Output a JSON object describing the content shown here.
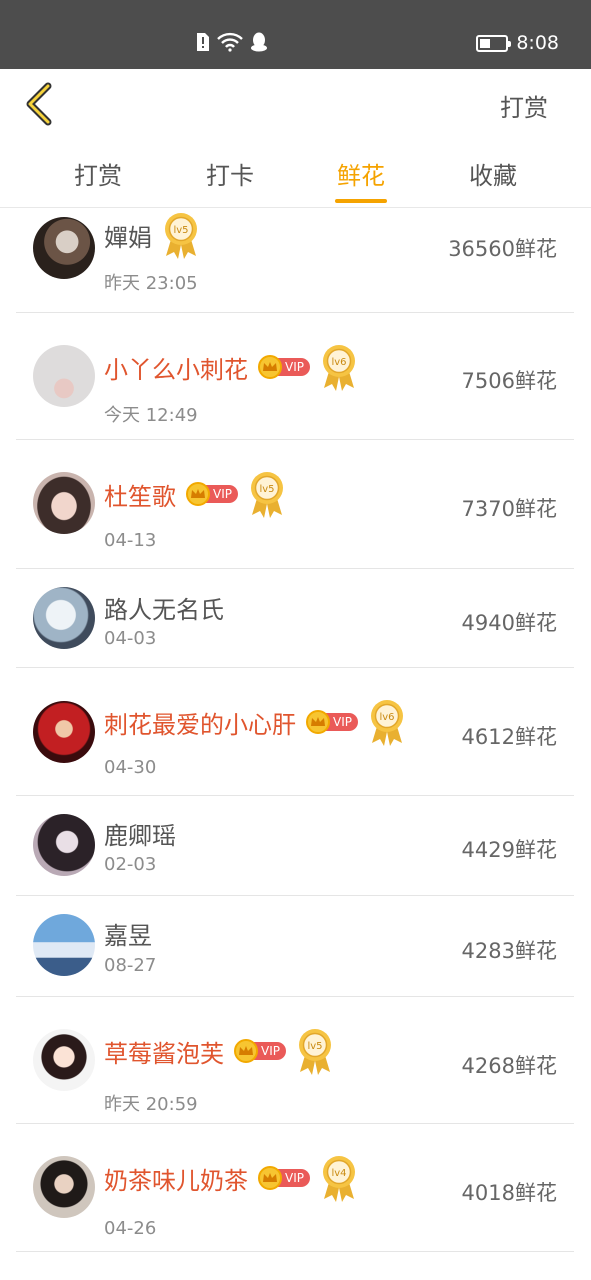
{
  "status": {
    "time": "8:08"
  },
  "nav": {
    "action": "打赏"
  },
  "tabs": [
    {
      "label": "打赏",
      "active": false
    },
    {
      "label": "打卡",
      "active": false
    },
    {
      "label": "鲜花",
      "active": true
    },
    {
      "label": "收藏",
      "active": false
    }
  ],
  "colors": {
    "accent": "#f5a300",
    "vip_name": "#e0552e",
    "vip_tag": "#ea5a58"
  },
  "rows": [
    {
      "name": "嬋娟",
      "vip": false,
      "level": "lv5",
      "time": "昨天 23:05",
      "amount": "36560鲜花"
    },
    {
      "name": "小丫么小刺花",
      "vip": true,
      "level": "lv6",
      "time": "今天 12:49",
      "amount": "7506鲜花"
    },
    {
      "name": "杜笙歌",
      "vip": true,
      "level": "lv5",
      "time": "04-13",
      "amount": "7370鲜花"
    },
    {
      "name": "路人无名氏",
      "vip": false,
      "level": "",
      "time": "04-03",
      "amount": "4940鲜花"
    },
    {
      "name": "刺花最爱的小心肝",
      "vip": true,
      "level": "lv6",
      "time": "04-30",
      "amount": "4612鲜花"
    },
    {
      "name": "鹿卿瑶",
      "vip": false,
      "level": "",
      "time": "02-03",
      "amount": "4429鲜花"
    },
    {
      "name": "嘉昱",
      "vip": false,
      "level": "",
      "time": "08-27",
      "amount": "4283鲜花"
    },
    {
      "name": "草莓酱泡芙",
      "vip": true,
      "level": "lv5",
      "time": "昨天 20:59",
      "amount": "4268鲜花"
    },
    {
      "name": "奶茶味儿奶茶",
      "vip": true,
      "level": "lv4",
      "time": "04-26",
      "amount": "4018鲜花"
    }
  ],
  "vip_label": "VIP"
}
